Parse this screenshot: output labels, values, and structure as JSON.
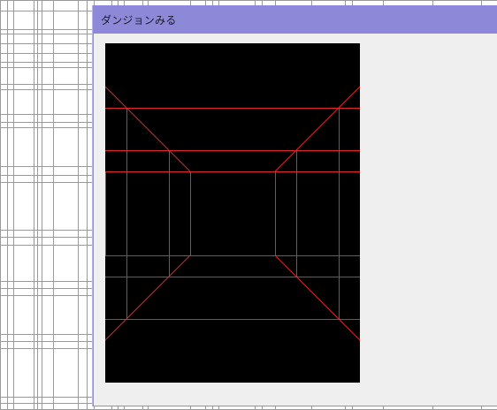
{
  "window": {
    "title": "ダンジョンみる"
  },
  "colors": {
    "title_bar": "#8d89d8",
    "window_bg": "#efeff0",
    "view_bg": "#000000",
    "wireframe": "#e02828",
    "background_grid": "#9a9a9a"
  },
  "dungeon_view": {
    "render": "wireframe-corridor",
    "visible_depth_levels": 3,
    "side_openings": {
      "left": [
        true,
        true,
        false
      ],
      "right": [
        true,
        true,
        false
      ]
    }
  }
}
